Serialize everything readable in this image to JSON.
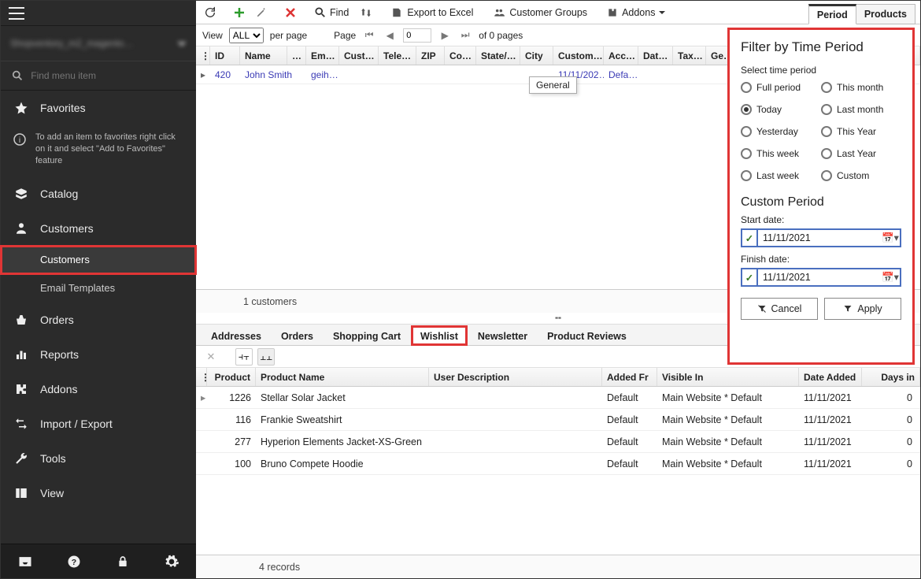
{
  "sidebar": {
    "search_placeholder": "Find menu item",
    "favorites": "Favorites",
    "fav_hint": "To add an item to favorites right click on it and select \"Add to Favorites\" feature",
    "items": {
      "catalog": "Catalog",
      "customers": "Customers",
      "customers_sub": "Customers",
      "email_templates": "Email Templates",
      "orders": "Orders",
      "reports": "Reports",
      "addons": "Addons",
      "import_export": "Import / Export",
      "tools": "Tools",
      "view": "View"
    }
  },
  "toolbar": {
    "find": "Find",
    "export_excel": "Export to Excel",
    "customer_groups": "Customer Groups",
    "addons": "Addons"
  },
  "right_tabs": {
    "period": "Period",
    "products": "Products"
  },
  "pager": {
    "view": "View",
    "all": "ALL",
    "per_page": "per page",
    "page": "Page",
    "current": "0",
    "of_pages": "of 0 pages"
  },
  "grid": {
    "headers": [
      "ID",
      "Name",
      "…",
      "Em…",
      "Cust…",
      "Tele…",
      "ZIP",
      "Co…",
      "State/…",
      "City",
      "Custom…",
      "Acc…",
      "Dat…",
      "Tax…",
      "Ge…"
    ],
    "row": {
      "id": "420",
      "name": "John Smith",
      "em": "geih…",
      "custom": "11/11/202…",
      "acc": "Defa…"
    },
    "tooltip": "General",
    "footer": "1 customers"
  },
  "bottom_tabs": [
    "Addresses",
    "Orders",
    "Shopping Cart",
    "Wishlist",
    "Newsletter",
    "Product Reviews"
  ],
  "wishlist": {
    "headers": [
      "Product",
      "Product Name",
      "User Description",
      "Added Fr",
      "Visible In",
      "Date Added",
      "Days in"
    ],
    "rows": [
      {
        "product": "1226",
        "name": "Stellar Solar Jacket",
        "added_from": "Default",
        "visible": "Main Website * Default",
        "date": "11/11/2021",
        "days": "0"
      },
      {
        "product": "116",
        "name": "Frankie  Sweatshirt",
        "added_from": "Default",
        "visible": "Main Website * Default",
        "date": "11/11/2021",
        "days": "0"
      },
      {
        "product": "277",
        "name": "Hyperion Elements Jacket-XS-Green",
        "added_from": "Default",
        "visible": "Main Website * Default",
        "date": "11/11/2021",
        "days": "0"
      },
      {
        "product": "100",
        "name": "Bruno Compete Hoodie",
        "added_from": "Default",
        "visible": "Main Website * Default",
        "date": "11/11/2021",
        "days": "0"
      }
    ],
    "footer": "4 records"
  },
  "filter": {
    "title": "Filter by Time Period",
    "select_label": "Select time period",
    "opts": {
      "full": "Full period",
      "this_month": "This month",
      "today": "Today",
      "last_month": "Last month",
      "yesterday": "Yesterday",
      "this_year": "This Year",
      "this_week": "This week",
      "last_year": "Last Year",
      "last_week": "Last week",
      "custom": "Custom"
    },
    "custom_title": "Custom Period",
    "start_label": "Start date:",
    "start_value": "11/11/2021",
    "finish_label": "Finish date:",
    "finish_value": "11/11/2021",
    "cancel": "Cancel",
    "apply": "Apply"
  }
}
